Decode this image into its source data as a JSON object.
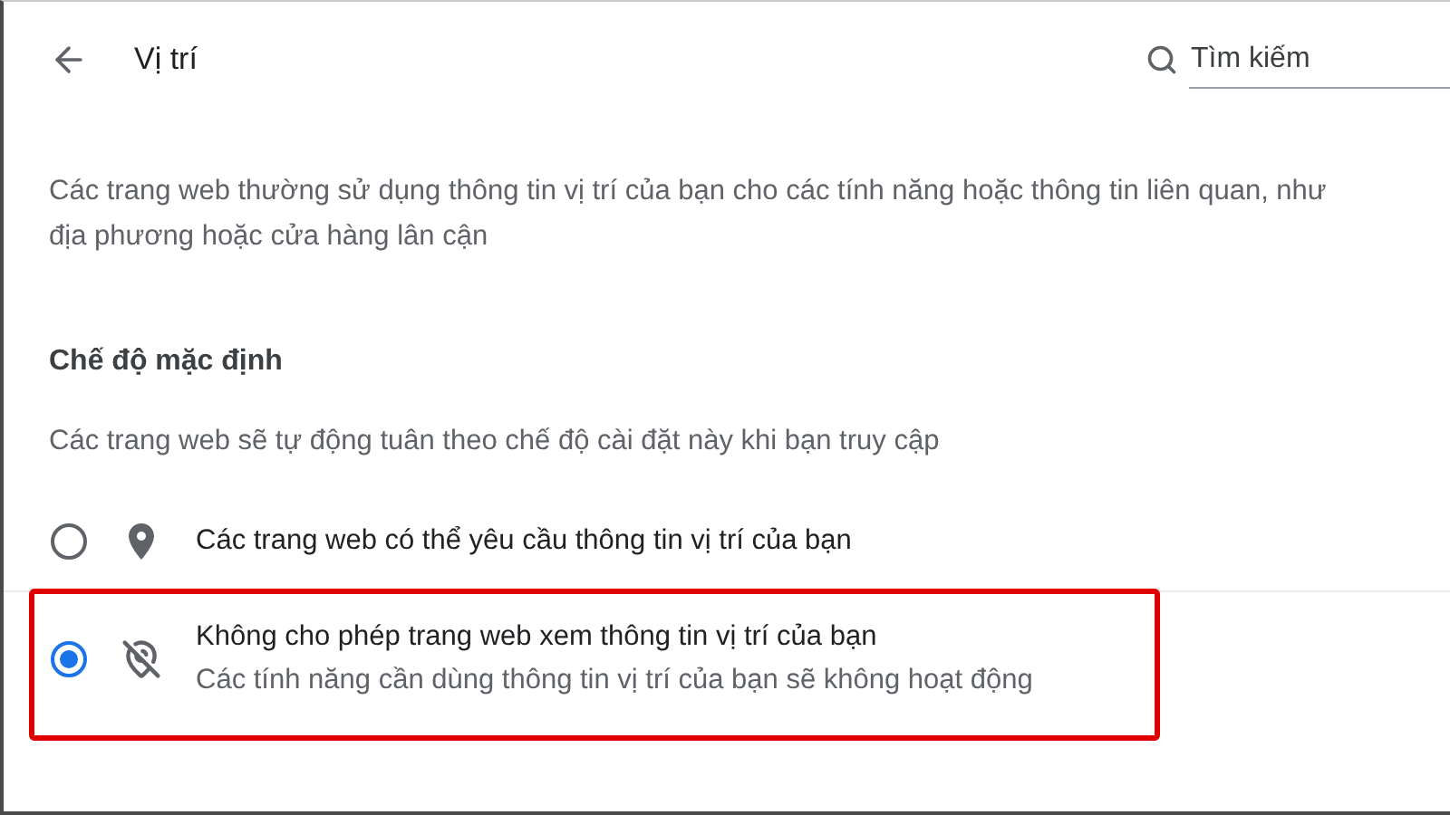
{
  "header": {
    "title": "Vị trí"
  },
  "search": {
    "placeholder": "Tìm kiếm"
  },
  "description": [
    "Các trang web thường sử dụng thông tin vị trí của bạn cho các tính năng hoặc thông tin liên quan, như",
    "địa phương hoặc cửa hàng lân cận"
  ],
  "section": {
    "title": "Chế độ mặc định",
    "subtitle": "Các trang web sẽ tự động tuân theo chế độ cài đặt này khi bạn truy cập"
  },
  "options": [
    {
      "kind": "allow",
      "label": "Các trang web có thể yêu cầu thông tin vị trí của bạn",
      "selected": false,
      "highlighted": false
    },
    {
      "kind": "block",
      "label": "Không cho phép trang web xem thông tin vị trí của bạn",
      "sublabel": "Các tính năng cần dùng thông tin vị trí của bạn sẽ không hoạt động",
      "selected": true,
      "highlighted": true
    }
  ]
}
